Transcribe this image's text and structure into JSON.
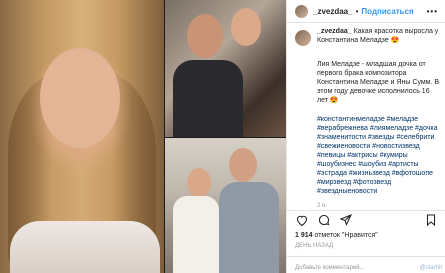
{
  "post": {
    "header": {
      "username": "_zvezdaa_",
      "dot": "•",
      "follow_label": "Подписаться",
      "more": "•••"
    },
    "caption": {
      "username": "_zvezdaa_",
      "text": " Какая красотка выросла у Константина Меладзе 😍"
    },
    "body": "Лия Меладзе - младшая дочка от первого брака композитора Константина Меладзе и Яны Сумм. В этом году девочке исполнилось 16 лет 😍",
    "hashtags": "#константинмеладзе #меладзе #верабрежнева #лиямеладзе #дочка #знаменитости #звезды #селебрити #свежиеновости #новостизвезд #певицы #актрисы #кумиры #шоубизнес #шоубиз #артисты #эстрада #жизньзвезд #вфотошопе #мирзвезд #фотозвезд #звездныеновости",
    "caption_time": "2 н.",
    "likes": {
      "count": "1 914",
      "text": " отметок \"Нравится\""
    },
    "time": "ДЕНЬ НАЗАД",
    "comment_placeholder": "Добавьте комментарий...",
    "watermark": "@starhit"
  },
  "icons": [
    "heart-icon",
    "comment-icon",
    "share-icon",
    "bookmark-icon"
  ]
}
